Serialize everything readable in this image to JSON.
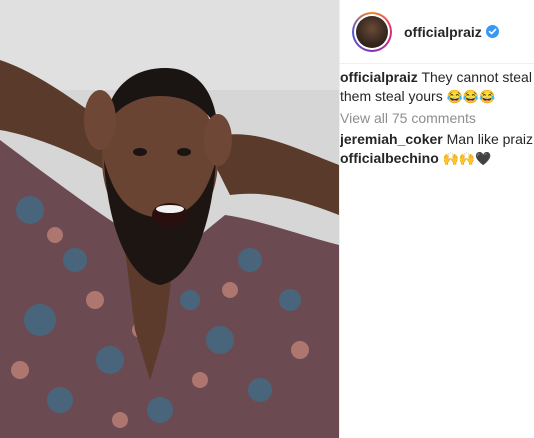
{
  "post": {
    "username": "officialpraiz",
    "verified_icon": "verified-badge-icon"
  },
  "caption": {
    "username": "officialpraiz",
    "text_line1": "They cannot steal",
    "text_line2": "them steal yours",
    "emojis": "😂😂😂"
  },
  "view_all_comments": "View all 75 comments",
  "comments": [
    {
      "username": "jeremiah_coker",
      "text": "Man like praiz"
    },
    {
      "username": "officialbechino",
      "text": "🙌🙌🖤"
    }
  ],
  "colors": {
    "verified": "#3897f0",
    "muted": "#8e8e8e",
    "text": "#262626"
  }
}
